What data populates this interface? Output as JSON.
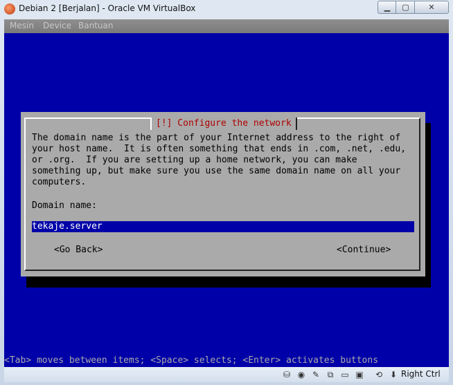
{
  "window": {
    "title": "Debian 2 [Berjalan] - Oracle VM VirtualBox"
  },
  "menu": [
    "Mesin",
    "Device",
    "Bantuan"
  ],
  "dialog": {
    "title": "[!] Configure the network",
    "description": "The domain name is the part of your Internet address to the right of\nyour host name.  It is often something that ends in .com, .net, .edu,\nor .org.  If you are setting up a home network, you can make\nsomething up, but make sure you use the same domain name on all your\ncomputers.",
    "field_label": "Domain name:",
    "field_value": "tekaje.server",
    "back_button": "<Go Back>",
    "continue_button": "<Continue>"
  },
  "help_line": "<Tab> moves between items; <Space> selects; <Enter> activates buttons",
  "status": {
    "host_key": "Right Ctrl"
  },
  "colors": {
    "screen_bg": "#0000a8",
    "dialog_bg": "#aaaaaa",
    "title_red": "#b00000"
  }
}
